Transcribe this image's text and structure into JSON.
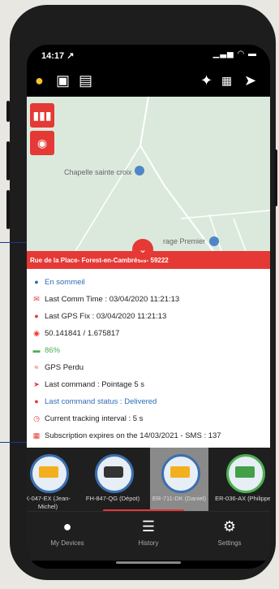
{
  "status_bar": {
    "time": "14:17",
    "location_arrow": "↗",
    "indicators": "▁▃▅ ◠ ▬"
  },
  "toolbar": {
    "left_icons": [
      "person-marker-icon",
      "map-device-icon",
      "archive-icon"
    ],
    "right_icons": [
      "walking-person-icon",
      "parking-icon",
      "send-icon"
    ]
  },
  "map": {
    "place_label": "Chapelle sainte croix",
    "place_label_2": "rage Premier",
    "controls": [
      "barcode-icon",
      "locate-icon"
    ]
  },
  "address": "Rue de la Place- Forest-en-Cambrésis- 59222",
  "info": [
    {
      "icon": "status-dot-icon",
      "text": "En sommeil",
      "color": "#2f6db5"
    },
    {
      "icon": "comm-icon",
      "text": "Last Comm Time : 03/04/2020 11:21:13",
      "color": "#222222"
    },
    {
      "icon": "gps-pin-icon",
      "text": "Last GPS Fix : 03/04/2020 11:21:13",
      "color": "#222222"
    },
    {
      "icon": "coordinates-icon",
      "text": "50.141841 / 1.675817",
      "color": "#222222"
    },
    {
      "icon": "battery-icon",
      "text": "86%",
      "color": "#4caf50"
    },
    {
      "icon": "gps-signal-icon",
      "text": "GPS Perdu",
      "color": "#222222"
    },
    {
      "icon": "command-icon",
      "text": "Last command : Pointage 5 s",
      "color": "#222222"
    },
    {
      "icon": "command-status-icon",
      "text": "Last command status : Delivered",
      "color": "#2f6db5"
    },
    {
      "icon": "clock-icon",
      "text": "Current tracking interval : 5 s",
      "color": "#222222"
    },
    {
      "icon": "calendar-icon",
      "text": "Subscription expires on the 14/03/2021 - SMS : 137",
      "color": "#222222"
    }
  ],
  "devices": [
    {
      "label": "K-047-EX (Jean-Michel)",
      "vehicle": "truck-icon",
      "selected": false
    },
    {
      "label": "FH-847-QG (Dépot)",
      "vehicle": "van-icon",
      "selected": false
    },
    {
      "label": "ER-711-DK (Daniel)",
      "vehicle": "truck-icon",
      "selected": true
    },
    {
      "label": "ER-036-AX (Philippe)",
      "vehicle": "truck-icon",
      "selected": false
    }
  ],
  "nav": {
    "my_devices": "My Devices",
    "history": "History",
    "settings": "Settings"
  },
  "colors": {
    "accent": "#e53935",
    "link": "#2f6db5",
    "battery": "#4caf50",
    "dark": "#1f1f1f"
  }
}
